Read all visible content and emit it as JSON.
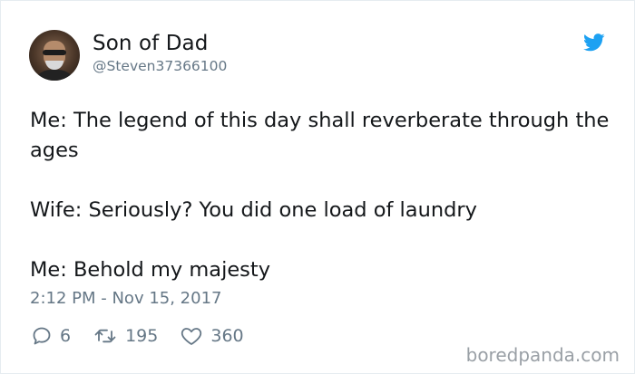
{
  "author": {
    "display_name": "Son of Dad",
    "handle": "@Steven37366100"
  },
  "tweet": {
    "lines": [
      "Me: The legend of this day shall reverberate through the ages",
      "Wife: Seriously? You did one load of laundry",
      "Me: Behold my majesty"
    ],
    "timestamp": "2:12 PM - Nov 15, 2017"
  },
  "stats": {
    "replies": "6",
    "retweets": "195",
    "likes": "360"
  },
  "watermark": "boredpanda.com",
  "colors": {
    "twitter_blue": "#1da1f2",
    "secondary_text": "#657786",
    "primary_text": "#14171a"
  }
}
